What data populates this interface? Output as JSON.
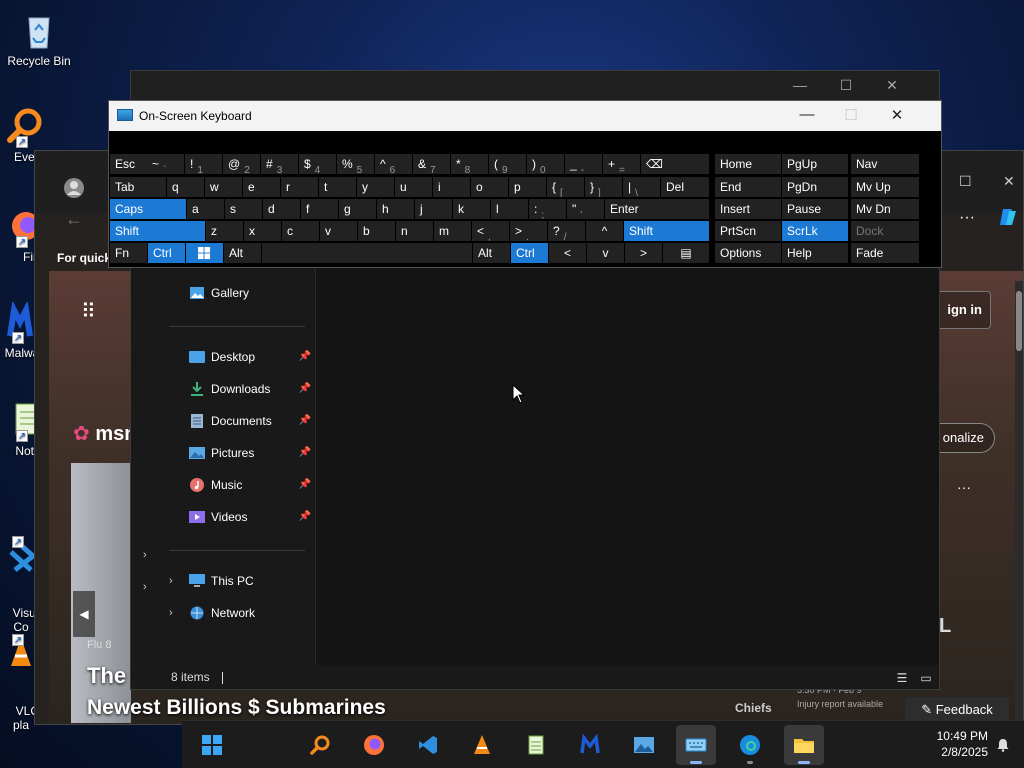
{
  "desktop": {
    "icons": [
      {
        "label": "Recycle Bin"
      },
      {
        "label": "Every"
      },
      {
        "label": "Fir"
      },
      {
        "label": "Malwa"
      },
      {
        "label": "Note"
      },
      {
        "label": "Visual\nCo"
      },
      {
        "label": "VLC\npla"
      }
    ]
  },
  "edge": {
    "for_quick": "For quick",
    "sign_in": "ign in",
    "personalize": "onalize",
    "msn": "msn",
    "news_source": "Flu",
    "news_count": "8",
    "news_title": "The Ex",
    "news_subtitle": "Newest Billions $ Submarines",
    "chiefs": "Chiefs",
    "injury": "Injury report available",
    "score_time": "5:30 PM · Feb 9",
    "feedback": "Feedback",
    "side_letter": "L"
  },
  "explorer": {
    "nav": {
      "gallery": "Gallery",
      "quick_access": [
        {
          "label": "Desktop",
          "icon": "desktop-icon",
          "color": "#4aa3e8"
        },
        {
          "label": "Downloads",
          "icon": "download-icon",
          "color": "#3fb37f"
        },
        {
          "label": "Documents",
          "icon": "documents-icon",
          "color": "#9bb7d6"
        },
        {
          "label": "Pictures",
          "icon": "pictures-icon",
          "color": "#5aa8e6"
        },
        {
          "label": "Music",
          "icon": "music-icon",
          "color": "#e7706a"
        },
        {
          "label": "Videos",
          "icon": "videos-icon",
          "color": "#8d6ee8"
        }
      ],
      "this_pc": "This PC",
      "network": "Network"
    },
    "status": "8 items"
  },
  "osk": {
    "title": "On-Screen Keyboard",
    "keys": {
      "esc": "Esc",
      "tilde": "~",
      "tilde_sub": "`",
      "d1": "!",
      "d1s": "1",
      "d2": "@",
      "d2s": "2",
      "d3": "#",
      "d3s": "3",
      "d4": "$",
      "d4s": "4",
      "d5": "%",
      "d5s": "5",
      "d6": "^",
      "d6s": "6",
      "d7": "&",
      "d7s": "7",
      "d8": "*",
      "d8s": "8",
      "d9": "(",
      "d9s": "9",
      "d0": ")",
      "d0s": "0",
      "minus": "_",
      "minus_s": "-",
      "plus": "+",
      "plus_s": "=",
      "backspace": "⌫",
      "tab": "Tab",
      "q": "q",
      "w": "w",
      "e": "e",
      "r": "r",
      "t": "t",
      "y": "y",
      "u": "u",
      "i": "i",
      "o": "o",
      "p": "p",
      "lbrace": "{",
      "lbrace_s": "[",
      "rbrace": "}",
      "rbrace_s": "]",
      "pipe": "|",
      "pipe_s": "\\",
      "del": "Del",
      "caps": "Caps",
      "a": "a",
      "s": "s",
      "d": "d",
      "f": "f",
      "g": "g",
      "h": "h",
      "j": "j",
      "k": "k",
      "l": "l",
      "colon": ":",
      "colon_s": ";",
      "quote": "\"",
      "quote_s": "'",
      "enter": "Enter",
      "shift": "Shift",
      "z": "z",
      "x": "x",
      "c": "c",
      "v": "v",
      "b": "b",
      "n": "n",
      "m": "m",
      "lt": "<",
      "lt_s": ",",
      "gt": ">",
      "gt_s": ".",
      "qm": "?",
      "qm_s": "/",
      "up": "^",
      "shift_r": "Shift",
      "fn": "Fn",
      "ctrl": "Ctrl",
      "alt": "Alt",
      "alt_r": "Alt",
      "ctrl_r": "Ctrl",
      "left": "<",
      "down": "v",
      "right": ">",
      "home": "Home",
      "pgup": "PgUp",
      "nav": "Nav",
      "end": "End",
      "pgdn": "PgDn",
      "mvup": "Mv Up",
      "insert": "Insert",
      "pause": "Pause",
      "mvdn": "Mv Dn",
      "prtscn": "PrtScn",
      "scrlk": "ScrLk",
      "dock": "Dock",
      "options": "Options",
      "help": "Help",
      "fade": "Fade"
    }
  },
  "taskbar": {
    "time": "10:49 PM",
    "date": "2/8/2025",
    "accent": "#1c7ad4"
  }
}
